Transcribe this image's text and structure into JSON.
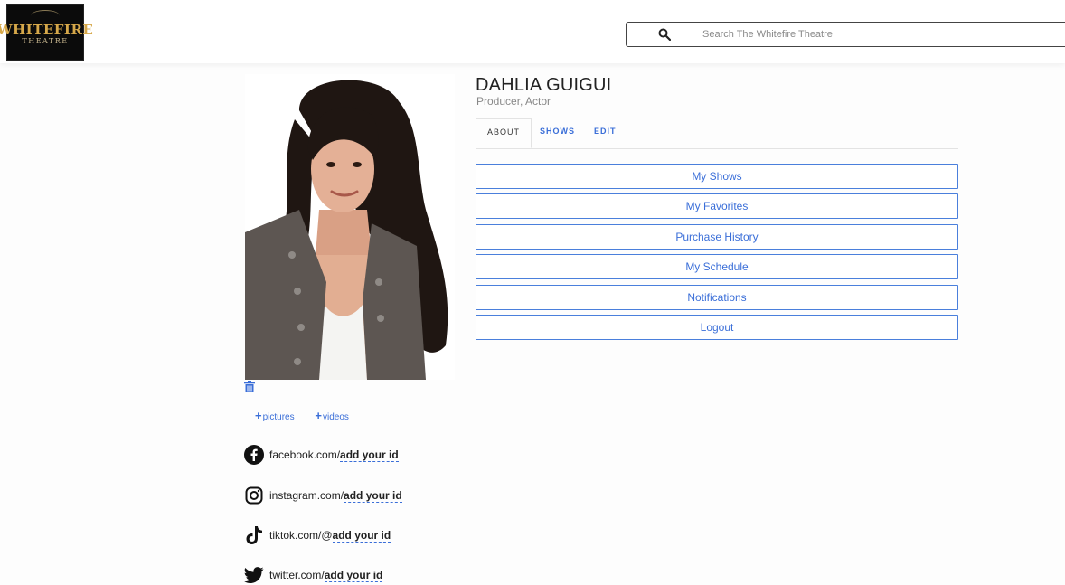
{
  "header": {
    "logo": {
      "line1": "WHITEFIRE",
      "line2": "THEATRE"
    },
    "search": {
      "placeholder": "Search The Whitefire Theatre",
      "value": ""
    }
  },
  "profile": {
    "name": "DAHLIA GUIGUI",
    "roles": "Producer, Actor",
    "tabs": [
      {
        "label": "ABOUT",
        "active": true
      },
      {
        "label": "SHOWS",
        "active": false
      },
      {
        "label": "EDIT",
        "active": false
      }
    ],
    "menu": [
      "My Shows",
      "My Favorites",
      "Purchase History",
      "My Schedule",
      "Notifications",
      "Logout"
    ]
  },
  "media": {
    "add_pictures": "pictures",
    "add_videos": "videos"
  },
  "social": [
    {
      "icon": "facebook-icon",
      "prefix": "facebook.com/",
      "link": "add your id"
    },
    {
      "icon": "instagram-icon",
      "prefix": "instagram.com/",
      "link": "add your id"
    },
    {
      "icon": "tiktok-icon",
      "prefix": "tiktok.com/@",
      "link": "add your id"
    },
    {
      "icon": "twitter-icon",
      "prefix": "twitter.com/",
      "link": "add your id"
    }
  ],
  "colors": {
    "accent": "#3a6ed8",
    "logo_gold": "#d6a84a"
  }
}
